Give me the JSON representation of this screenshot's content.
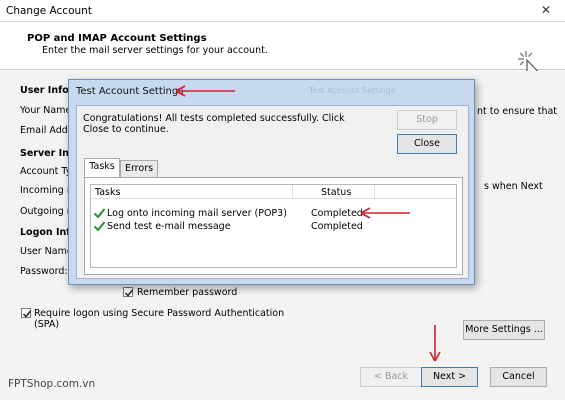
{
  "window": {
    "title": "Change Account",
    "close_glyph": "✕"
  },
  "header": {
    "title": "POP and IMAP Account Settings",
    "subtitle": "Enter the mail server settings for your account."
  },
  "background": {
    "user_info_label": "User Inform",
    "your_name_label": "Your Name:",
    "email_label": "Email Addre",
    "server_info_label": "Server Infor",
    "account_type_label": "Account Typ",
    "incoming_label": "Incoming m",
    "outgoing_label": "Outgoing m",
    "logon_info_label": "Logon Info",
    "username_label": "User Name:",
    "password_label": "Password:",
    "right_text_1": "nt to ensure that",
    "right_text_2": "s when Next",
    "remember_password": "Remember password",
    "require_spa": "Require logon using Secure Password Authentication",
    "require_spa_2": "(SPA)",
    "more_settings": "More Settings ...",
    "back": "< Back",
    "next": "Next >",
    "cancel": "Cancel"
  },
  "dialog": {
    "title": "Test Account Settings",
    "ghost_title": "Test Account Settings",
    "message": "Congratulations! All tests completed successfully. Click Close to continue.",
    "stop": "Stop",
    "close": "Close",
    "tabs": [
      {
        "label": "Tasks"
      },
      {
        "label": "Errors"
      }
    ],
    "columns": {
      "tasks": "Tasks",
      "status": "Status"
    },
    "rows": [
      {
        "task": "Log onto incoming mail server (POP3)",
        "status": "Completed"
      },
      {
        "task": "Send test e-mail message",
        "status": "Completed"
      }
    ]
  },
  "watermark": "FPTShop.com.vn",
  "colors": {
    "annotation": "#d0202a",
    "check": "#2e8b2e",
    "dialog_frame": "#c6d9ee"
  }
}
